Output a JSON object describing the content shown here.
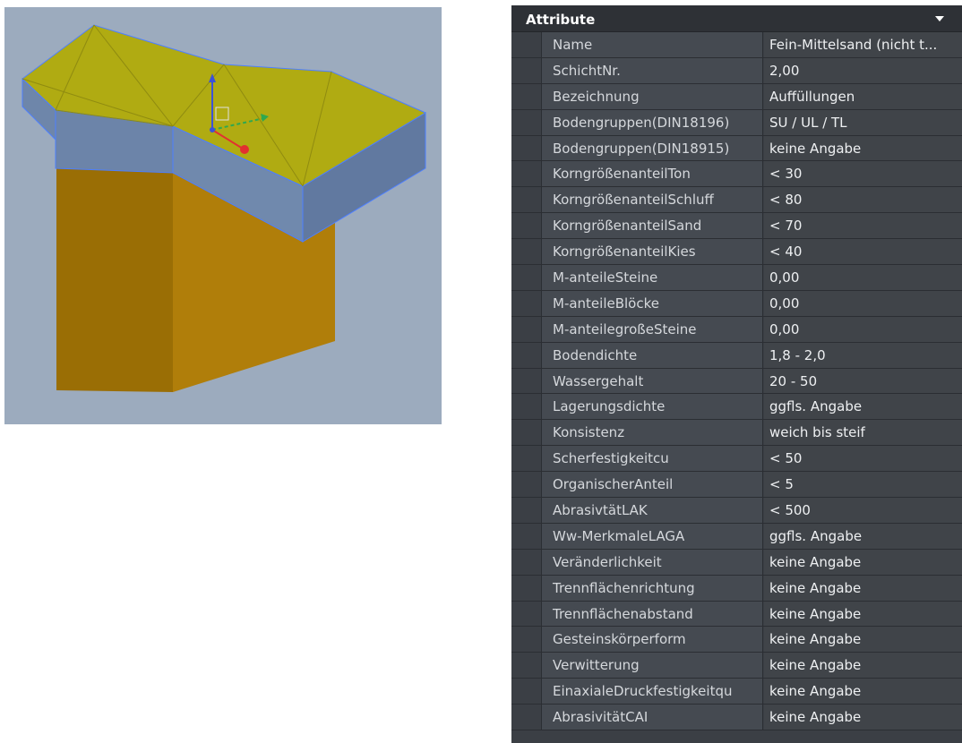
{
  "panel": {
    "title": "Attribute",
    "collapse_icon": "chevron-down-icon",
    "rows": [
      {
        "key": "Name",
        "value": "Fein-Mittelsand (nicht t..."
      },
      {
        "key": "SchichtNr.",
        "value": "2,00"
      },
      {
        "key": "Bezeichnung",
        "value": "Auffüllungen"
      },
      {
        "key": "Bodengruppen(DIN18196)",
        "value": "SU / UL / TL"
      },
      {
        "key": "Bodengruppen(DIN18915)",
        "value": "keine Angabe"
      },
      {
        "key": "KorngrößenanteilTon",
        "value": "< 30"
      },
      {
        "key": "KorngrößenanteilSchluff",
        "value": "< 80"
      },
      {
        "key": "KorngrößenanteilSand",
        "value": "< 70"
      },
      {
        "key": "KorngrößenanteilKies",
        "value": "< 40"
      },
      {
        "key": "M-anteileSteine",
        "value": "0,00"
      },
      {
        "key": "M-anteileBlöcke",
        "value": "0,00"
      },
      {
        "key": "M-anteilegroßeSteine",
        "value": "0,00"
      },
      {
        "key": "Bodendichte",
        "value": "1,8 - 2,0"
      },
      {
        "key": "Wassergehalt",
        "value": "20 - 50"
      },
      {
        "key": "Lagerungsdichte",
        "value": "ggfls. Angabe"
      },
      {
        "key": "Konsistenz",
        "value": "weich bis steif"
      },
      {
        "key": "Scherfestigkeitcu",
        "value": "< 50"
      },
      {
        "key": "OrganischerAnteil",
        "value": "< 5"
      },
      {
        "key": "AbrasivtätLAK",
        "value": "< 500"
      },
      {
        "key": "Ww-MerkmaleLAGA",
        "value": "ggfls. Angabe"
      },
      {
        "key": "Veränderlichkeit",
        "value": "keine Angabe"
      },
      {
        "key": "Trennflächenrichtung",
        "value": "keine Angabe"
      },
      {
        "key": "Trennflächenabstand",
        "value": "keine Angabe"
      },
      {
        "key": "Gesteinskörperform",
        "value": "keine Angabe"
      },
      {
        "key": "Verwitterung",
        "value": "keine Angabe"
      },
      {
        "key": "EinaxialeDruckfestigkeitqu",
        "value": "keine Angabe"
      },
      {
        "key": "AbrasivitätCAI",
        "value": "keine Angabe"
      }
    ]
  },
  "viewport": {
    "background": "#9cabbe",
    "colors": {
      "top_layer": "#b2ad12",
      "middle_layer": "#6c86ab",
      "bottom_layer": "#a87808",
      "selection_edge": "#4d7fff",
      "axis_x": "#e23030",
      "axis_y": "#2fa84f",
      "axis_z": "#3c52d8"
    }
  }
}
